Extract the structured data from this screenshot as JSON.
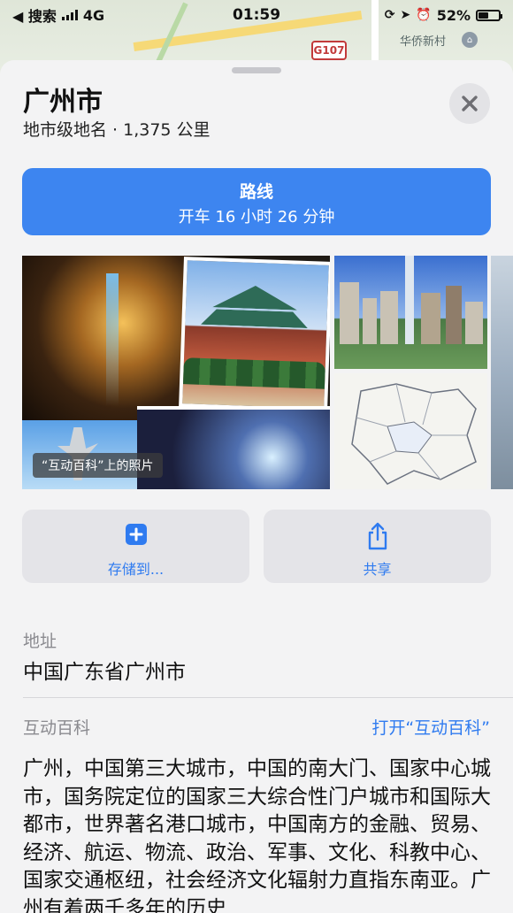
{
  "status_bar": {
    "back_app": "◀ 搜索",
    "network": "4G",
    "time": "01:59",
    "battery_percent": "52%",
    "battery_level": 0.52
  },
  "map": {
    "road_shield": "G107",
    "place_label": "华侨新村"
  },
  "place": {
    "title": "广州市",
    "subtitle": "地市级地名 · 1,375 公里"
  },
  "route": {
    "label": "路线",
    "time": "开车 16 小时 26 分钟"
  },
  "gallery": {
    "caption": "“互动百科”上的照片"
  },
  "actions": {
    "save_label": "存储到...",
    "share_label": "共享"
  },
  "address": {
    "label": "地址",
    "value": "中国广东省广州市"
  },
  "wiki": {
    "label": "互动百科",
    "open_label": "打开“互动百科”",
    "text": "广州，中国第三大城市，中国的南大门、国家中心城市，国务院定位的国家三大综合性门户城市和国际大都市，世界著名港口城市，中国南方的金融、贸易、经济、航运、物流、政治、军事、文化、科教中心、国家交通枢纽，社会经济文化辐射力直指东南亚。广州有着两千多年的历史"
  },
  "colors": {
    "accent": "#3d85f0",
    "link": "#2f7bf0",
    "sheet_bg": "#f3f3f4"
  }
}
